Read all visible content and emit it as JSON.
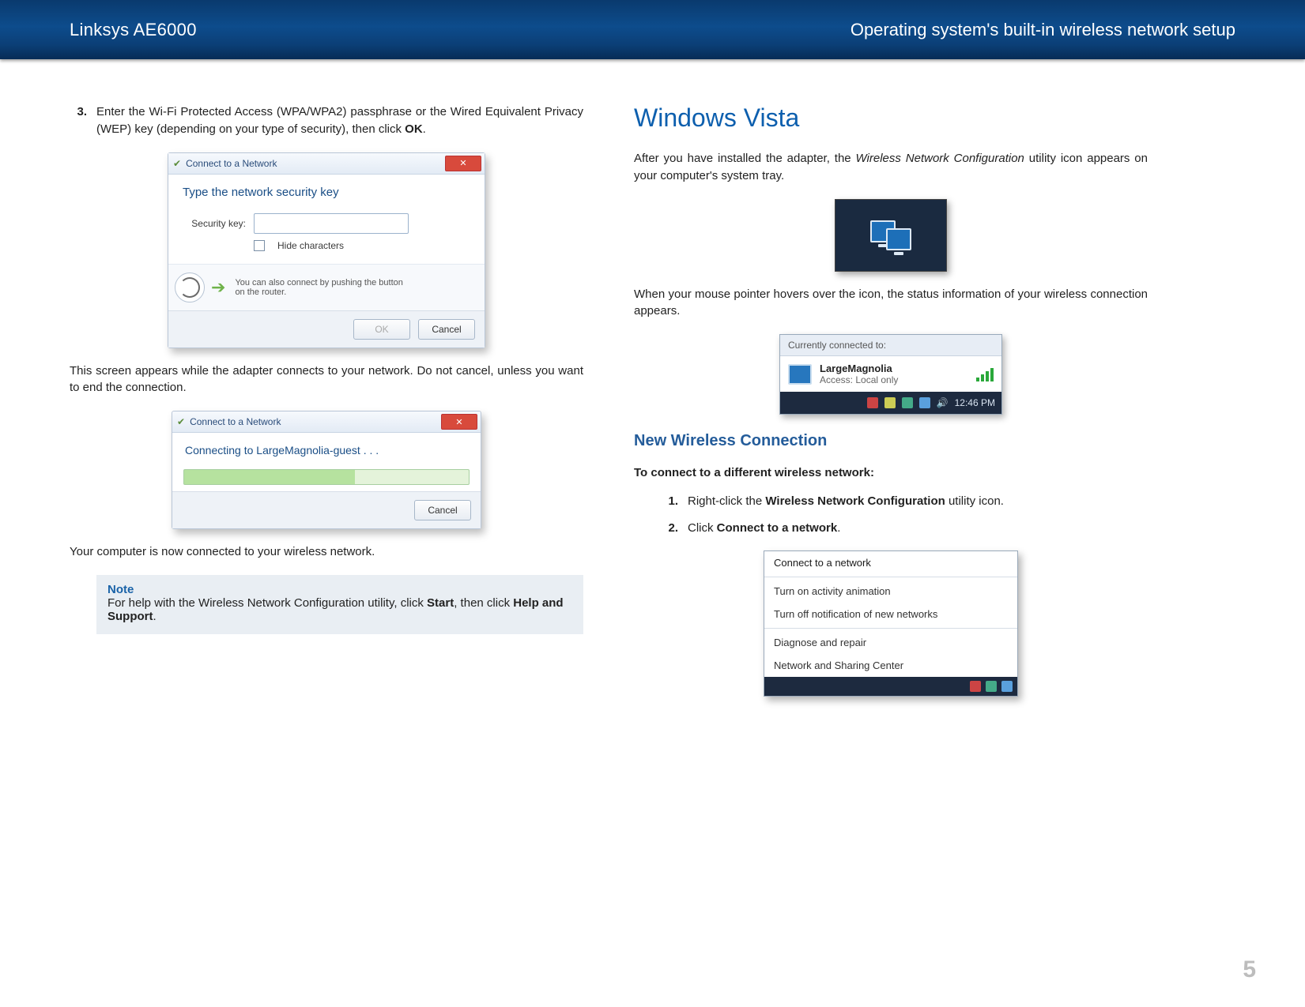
{
  "banner": {
    "left": "Linksys AE6000",
    "right": "Operating system's built-in wireless network setup"
  },
  "page_number": "5",
  "left_col": {
    "step3_num": "3.",
    "step3_text_before": "Enter the Wi-Fi Protected Access (WPA/WPA2) passphrase or the  Wired Equivalent Privacy (WEP) key (depending on your type of security), then click ",
    "step3_bold": "OK",
    "step3_after": ".",
    "dlg1": {
      "title": "Connect to a Network",
      "heading": "Type the network security key",
      "label": "Security key:",
      "hide": "Hide characters",
      "push": "You can also connect by pushing the button on the router.",
      "ok": "OK",
      "cancel": "Cancel"
    },
    "para_after_dlg1": "This screen appears while the adapter connects to your network. Do not cancel, unless you want to end the connection.",
    "dlg2": {
      "title": "Connect to a Network",
      "text": "Connecting to LargeMagnolia-guest . . .",
      "cancel": "Cancel"
    },
    "connected": "Your computer is now connected to your wireless network.",
    "note_title": "Note",
    "note_before": "For help with the Wireless Network Configuration utility, click ",
    "note_b1": "Start",
    "note_mid": ", then click ",
    "note_b2": "Help and Support",
    "note_after": "."
  },
  "right_col": {
    "h1": "Windows Vista",
    "p1_before": "After you have installed the adapter, the ",
    "p1_italic": "Wireless Network Configuration",
    "p1_after": " utility icon appears on your computer's system tray.",
    "p2": "When your mouse pointer hovers over the icon, the status information of your wireless connection appears.",
    "status": {
      "head": "Currently connected to:",
      "name": "LargeMagnolia",
      "access": "Access:  Local only",
      "time": "12:46 PM"
    },
    "h2": "New Wireless Connection",
    "bold_intro": "To connect to a different wireless network:",
    "s1_num": "1.",
    "s1_before": "Right-click the ",
    "s1_bold": "Wireless Network Configuration",
    "s1_after": " utility icon.",
    "s2_num": "2.",
    "s2_before": "Click ",
    "s2_bold": "Connect to a network",
    "s2_after": ".",
    "ctx": {
      "i1": "Connect to a network",
      "i2": "Turn on activity animation",
      "i3": "Turn off notification of new networks",
      "i4": "Diagnose and repair",
      "i5": "Network and Sharing Center"
    }
  }
}
